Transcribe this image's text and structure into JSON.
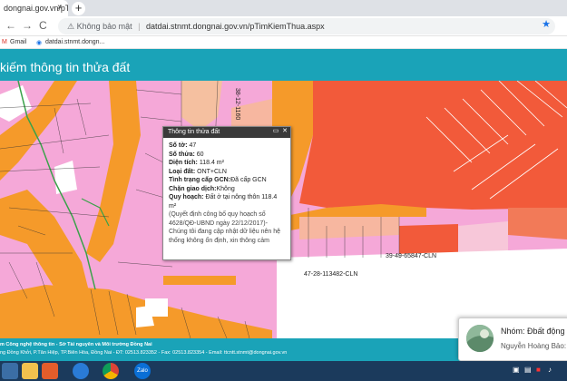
{
  "browser": {
    "tab_title": "dongnai.gov.vn/pT",
    "tab_close": "×",
    "new_tab": "+",
    "back": "←",
    "forward": "→",
    "reload": "C",
    "security_label": "Không bảo mật",
    "url": "datdai.stnmt.dongnai.gov.vn/pTimKiemThua.aspx",
    "bookmarks": [
      "Gmail",
      "datdai.stnmt.dongn..."
    ]
  },
  "page": {
    "title": "kiếm thông tin thửa đất"
  },
  "popup": {
    "title": "Thông tin thửa đất",
    "rows": [
      {
        "label": "Số tờ:",
        "value": "47"
      },
      {
        "label": "Số thửa:",
        "value": "60"
      },
      {
        "label": "Diện tích:",
        "value": "118.4 m²"
      },
      {
        "label": "Loại đất:",
        "value": "ONT+CLN"
      },
      {
        "label": "Tình trạng cấp GCN:",
        "value": "Đã cấp GCN"
      },
      {
        "label": "Chặn giao dịch:",
        "value": "Không"
      },
      {
        "label": "Quy hoạch:",
        "value": "Đất ở tại nông thôn 118.4 m²"
      }
    ],
    "note": "(Quyết định công bố quy hoạch số 4628/QĐ-UBND ngày 22/12/2017)- Chúng tôi đang cập nhật dữ liệu nên hệ thống không ổn định, xin thông cảm"
  },
  "map_labels": {
    "label1": "47-28-113482-CLN",
    "label2": "39-49-65847-CLN",
    "label3": "38-12-1160"
  },
  "footer": {
    "line1": "m Công nghệ thông tin - Sở Tài nguyên và Môi trường Đồng Nai",
    "line2": "ng Đồng Khởi, P.Tân Hiệp, TP.Biên Hòa, Đồng Nai - ĐT: 02513.823352 - Fax: 02513.823354 - Email: ttcntt.stnmt@dongnai.gov.vn"
  },
  "notification": {
    "name": "Nhóm: Ðbất động",
    "sub": "Nguyễn Hoàng Bảo:"
  },
  "taskbar": {
    "zalo": "Zalo"
  },
  "colors": {
    "header": "#1aa3b8",
    "land_pink": "#f5a8d8",
    "land_orange": "#f59a2a",
    "land_red": "#f25a3a"
  }
}
